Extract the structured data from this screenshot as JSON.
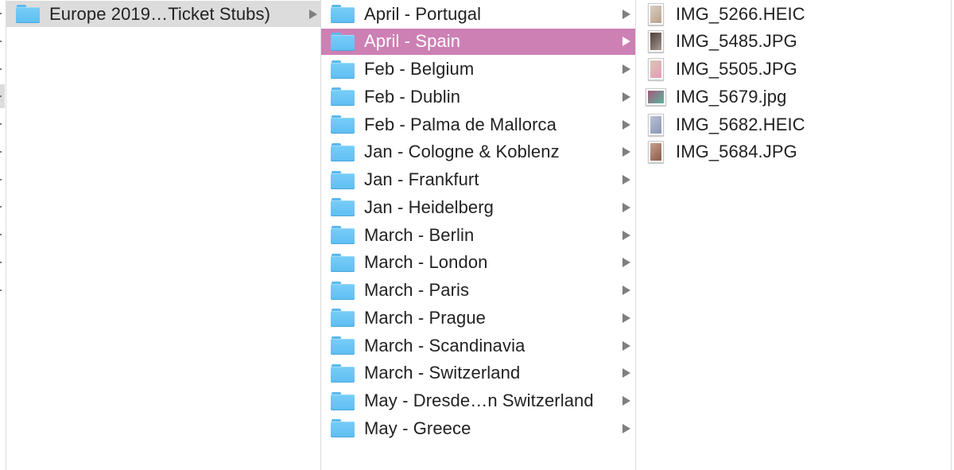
{
  "window": {
    "view_mode": "column-view"
  },
  "colors": {
    "selection_active": "#cd80b4",
    "selection_inactive": "#dcdcdc",
    "folder": "#6cc6f5",
    "text": "#222222",
    "disclosure_arrow": "#7f7f7f"
  },
  "columns": [
    {
      "items": [
        {
          "label": "Europe 2019…Ticket Stubs)",
          "type": "folder",
          "selected": true,
          "has_children": true
        }
      ]
    },
    {
      "items": [
        {
          "label": "April - Portugal",
          "type": "folder",
          "selected": false,
          "has_children": true
        },
        {
          "label": "April - Spain",
          "type": "folder",
          "selected": true,
          "has_children": true
        },
        {
          "label": "Feb - Belgium",
          "type": "folder",
          "selected": false,
          "has_children": true
        },
        {
          "label": "Feb - Dublin",
          "type": "folder",
          "selected": false,
          "has_children": true
        },
        {
          "label": "Feb - Palma de Mallorca",
          "type": "folder",
          "selected": false,
          "has_children": true
        },
        {
          "label": "Jan - Cologne & Koblenz",
          "type": "folder",
          "selected": false,
          "has_children": true
        },
        {
          "label": "Jan - Frankfurt",
          "type": "folder",
          "selected": false,
          "has_children": true
        },
        {
          "label": "Jan - Heidelberg",
          "type": "folder",
          "selected": false,
          "has_children": true
        },
        {
          "label": "March - Berlin",
          "type": "folder",
          "selected": false,
          "has_children": true
        },
        {
          "label": "March - London",
          "type": "folder",
          "selected": false,
          "has_children": true
        },
        {
          "label": "March - Paris",
          "type": "folder",
          "selected": false,
          "has_children": true
        },
        {
          "label": "March - Prague",
          "type": "folder",
          "selected": false,
          "has_children": true
        },
        {
          "label": "March - Scandinavia",
          "type": "folder",
          "selected": false,
          "has_children": true
        },
        {
          "label": "March - Switzerland",
          "type": "folder",
          "selected": false,
          "has_children": true
        },
        {
          "label": "May - Dresde…n Switzerland",
          "type": "folder",
          "selected": false,
          "has_children": true
        },
        {
          "label": "May - Greece",
          "type": "folder",
          "selected": false,
          "has_children": true
        }
      ]
    },
    {
      "items": [
        {
          "label": "IMG_5266.HEIC",
          "type": "image",
          "thumb": [
            "#d8cfc4",
            "#b9a08a"
          ],
          "orientation": "portrait"
        },
        {
          "label": "IMG_5485.JPG",
          "type": "image",
          "thumb": [
            "#4a3d3a",
            "#a89a94"
          ],
          "orientation": "portrait"
        },
        {
          "label": "IMG_5505.JPG",
          "type": "image",
          "thumb": [
            "#d9c7b4",
            "#e79ab8"
          ],
          "orientation": "portrait"
        },
        {
          "label": "IMG_5679.jpg",
          "type": "image",
          "thumb": [
            "#a45a7a",
            "#5ab4a0"
          ],
          "orientation": "landscape"
        },
        {
          "label": "IMG_5682.HEIC",
          "type": "image",
          "thumb": [
            "#b8c2d6",
            "#8a95b4"
          ],
          "orientation": "portrait"
        },
        {
          "label": "IMG_5684.JPG",
          "type": "image",
          "thumb": [
            "#c8a08c",
            "#8a5a48"
          ],
          "orientation": "portrait"
        }
      ]
    }
  ],
  "previous_column": {
    "visible_arrow_rows": 11,
    "selected_row_index": 3
  }
}
